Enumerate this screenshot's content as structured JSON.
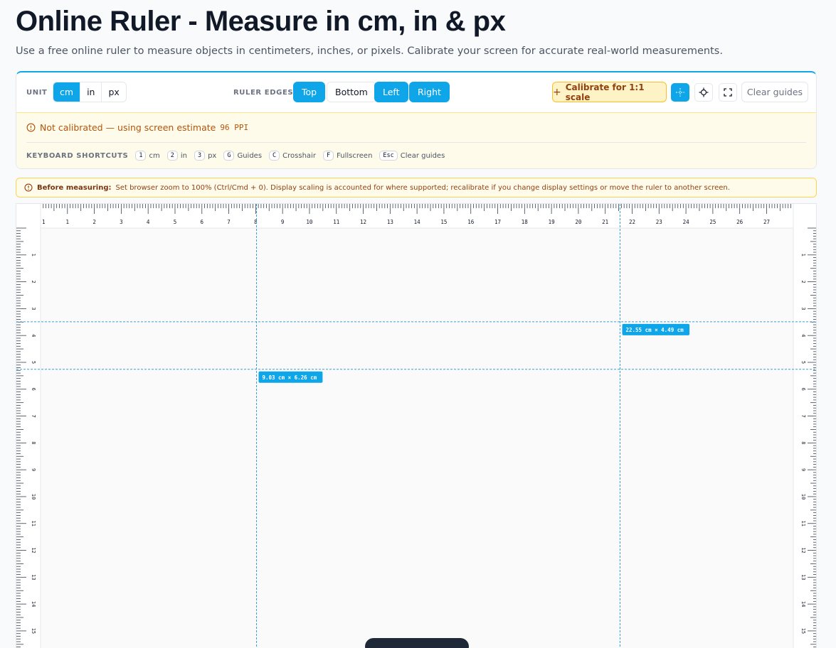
{
  "page": {
    "title": "Online Ruler - Measure in cm, in & px",
    "description": "Use a free online ruler to measure objects in centimeters, inches, or pixels. Calibrate your screen for accurate real-world measurements."
  },
  "toolbar": {
    "unit_label": "UNIT",
    "units": [
      {
        "label": "cm",
        "active": true
      },
      {
        "label": "in",
        "active": false
      },
      {
        "label": "px",
        "active": false
      }
    ],
    "edges_label": "RULER EDGES",
    "edges": [
      {
        "label": "Top",
        "active": true
      },
      {
        "label": "Bottom",
        "active": false
      },
      {
        "label": "Left",
        "active": true
      },
      {
        "label": "Right",
        "active": true
      }
    ],
    "calibrate_label": "Calibrate for 1:1 scale",
    "clear_guides_label": "Clear guides",
    "icons": [
      "guides-icon",
      "crosshair-icon",
      "fullscreen-icon"
    ]
  },
  "calibration": {
    "status": "Not calibrated — using screen estimate",
    "ppi": "96 PPI"
  },
  "shortcuts": {
    "title": "KEYBOARD SHORTCUTS",
    "items": [
      {
        "key": "1",
        "label": "cm"
      },
      {
        "key": "2",
        "label": "in"
      },
      {
        "key": "3",
        "label": "px"
      },
      {
        "key": "G",
        "label": "Guides"
      },
      {
        "key": "C",
        "label": "Crosshair"
      },
      {
        "key": "F",
        "label": "Fullscreen"
      },
      {
        "key": "Esc",
        "label": "Clear guides"
      }
    ]
  },
  "notice": {
    "bold": "Before measuring:",
    "text": "Set browser zoom to 100% (Ctrl/Cmd + 0). Display scaling is accounted for where supported; recalibrate if you change display settings or move the ruler to another screen."
  },
  "ruler": {
    "unit": "cm",
    "ppi": 96,
    "top_labels_max": 34,
    "side_labels_max": 19,
    "guides": {
      "vertical_cm": [
        9.03,
        22.55
      ],
      "horizontal_cm": [
        4.49,
        6.26
      ]
    },
    "readouts": [
      "22.55 cm × 4.49 cm",
      "9.03 cm × 6.26 cm"
    ],
    "colors": {
      "guide": "#3b9fd6",
      "badge": "#0ea5e9",
      "tick": "#374151"
    }
  }
}
